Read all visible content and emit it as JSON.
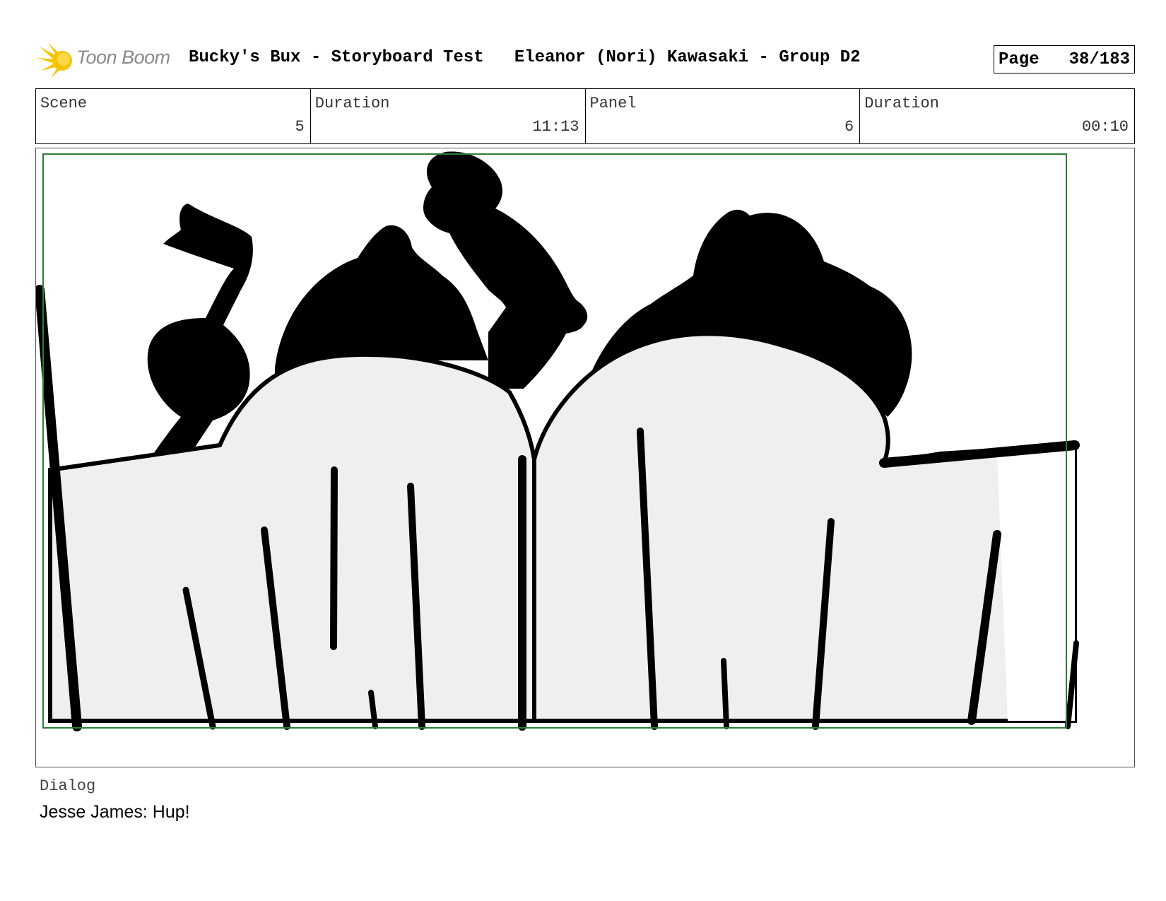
{
  "header": {
    "logo_text": "Toon Boom",
    "title": "Bucky's Bux - Storyboard Test   Eleanor (Nori) Kawasaki - Group D2",
    "page_label": "Page",
    "page_value": "38/183"
  },
  "info": {
    "scene_label": "Scene",
    "scene_value": "5",
    "scene_duration_label": "Duration",
    "scene_duration_value": "11:13",
    "panel_label": "Panel",
    "panel_value": "6",
    "panel_duration_label": "Duration",
    "panel_duration_value": "00:10"
  },
  "dialog": {
    "label": "Dialog",
    "text": "Jesse James: Hup!"
  },
  "colors": {
    "safe_frame": "#2e7d32",
    "sack_fill": "#efefef",
    "ink": "#000000",
    "logo_star": "#f5c400"
  }
}
